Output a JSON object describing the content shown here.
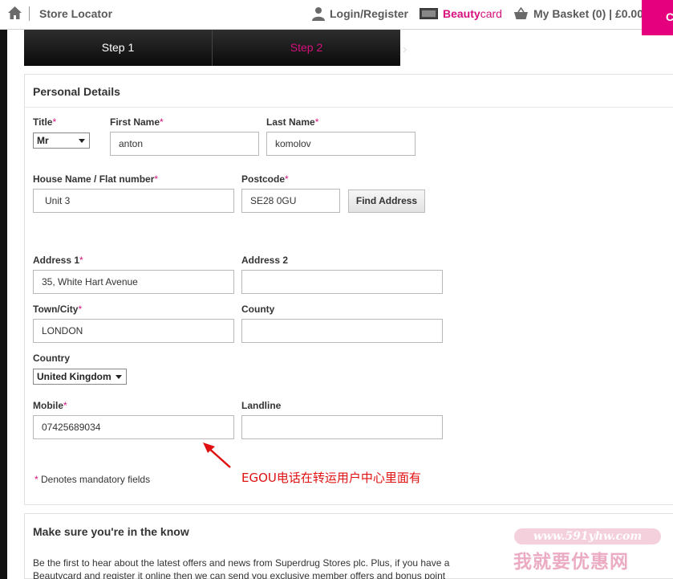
{
  "header": {
    "store_locator": "Store Locator",
    "login": "Login/Register",
    "beautycard_a": "Beauty",
    "beautycard_b": "card",
    "basket": "My Basket (0) | £0.00",
    "pink_button": "C",
    "accent": "#d6107d"
  },
  "steps": {
    "step1": "Step 1",
    "step2": "Step 2",
    "arrow": "›"
  },
  "personal": {
    "title": "Personal Details",
    "title_label": "Title",
    "title_value": "Mr",
    "first_name_label": "First Name",
    "first_name_value": "anton",
    "last_name_label": "Last Name",
    "last_name_value": "komolov",
    "house_label": "House Name / Flat number",
    "house_value": "Unit 3",
    "postcode_label": "Postcode",
    "postcode_value": "SE28 0GU",
    "find_address": "Find Address",
    "address1_label": "Address 1",
    "address1_value": "35, White Hart Avenue",
    "address2_label": "Address 2",
    "address2_value": "",
    "town_label": "Town/City",
    "town_value": "LONDON",
    "county_label": "County",
    "county_value": "",
    "country_label": "Country",
    "country_value": "United Kingdom",
    "mobile_label": "Mobile",
    "mobile_value": "07425689034",
    "landline_label": "Landline",
    "landline_value": "",
    "required_mark": "*",
    "mandatory_note": "Denotes mandatory fields"
  },
  "annotation": {
    "text": "EGOU电话在转运用户中心里面有",
    "color": "#e01010"
  },
  "know": {
    "title": "Make sure you're in the know",
    "body": "Be the first to hear about the latest offers and news from Superdrug Stores plc. Plus, if you have a Beautycard and register it online then we can send you exclusive member offers and bonus point"
  },
  "watermark": {
    "url": "www.591yhw.com",
    "text": "我就要优惠网"
  }
}
